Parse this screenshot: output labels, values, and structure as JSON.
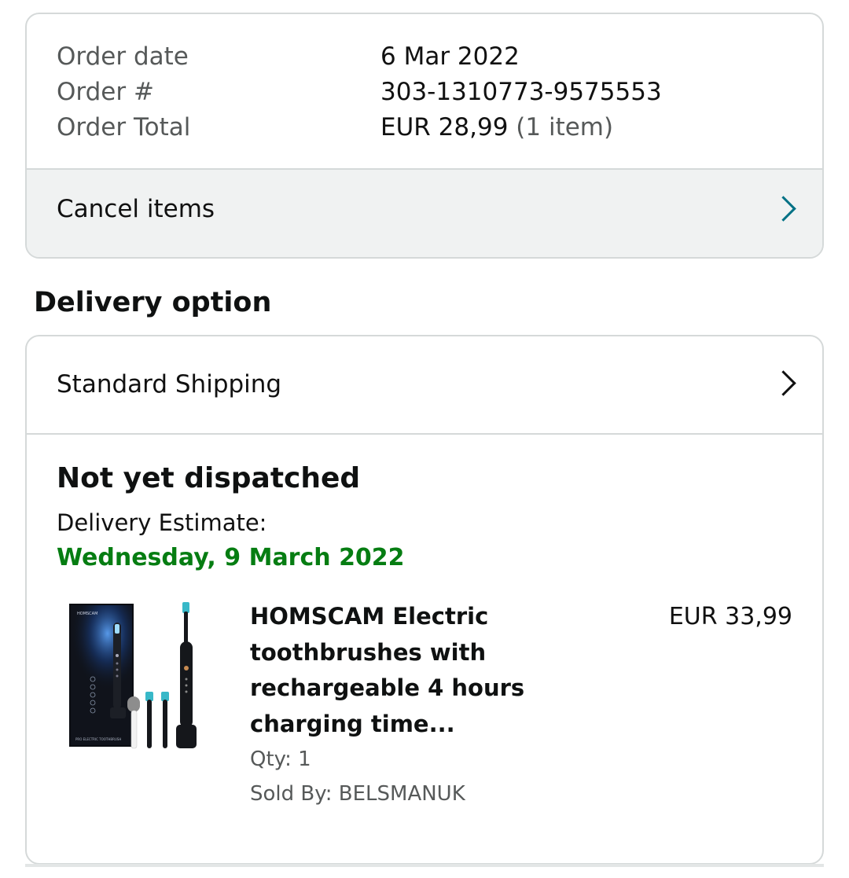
{
  "order_summary": {
    "rows": [
      {
        "label": "Order date",
        "value": "6 Mar 2022",
        "suffix": ""
      },
      {
        "label": "Order #",
        "value": "303-1310773-9575553",
        "suffix": ""
      },
      {
        "label": "Order Total",
        "value": "EUR 28,99",
        "suffix": "(1 item)"
      }
    ],
    "cancel_label": "Cancel items"
  },
  "delivery": {
    "heading": "Delivery option",
    "shipping_method": "Standard Shipping",
    "status": "Not yet dispatched",
    "estimate_label": "Delivery Estimate:",
    "estimate_date": "Wednesday, 9 March 2022",
    "estimate_color": "#067d12"
  },
  "product": {
    "title": "HOMSCAM Electric toothbrushes with rechargeable 4 hours charging time...",
    "price": "EUR 33,99",
    "qty": "Qty: 1",
    "seller": "Sold By: BELSMANUK",
    "image_icon": "toothbrush-product-image",
    "box_brand_text": "HOMSCAM",
    "box_caption_text": "PRO ELECTRIC TOOTHBRUSH"
  },
  "colors": {
    "accent_chevron": "#007185",
    "border": "#d5d9d9",
    "muted_text": "#565959",
    "cancel_row_bg": "#f0f2f2"
  }
}
